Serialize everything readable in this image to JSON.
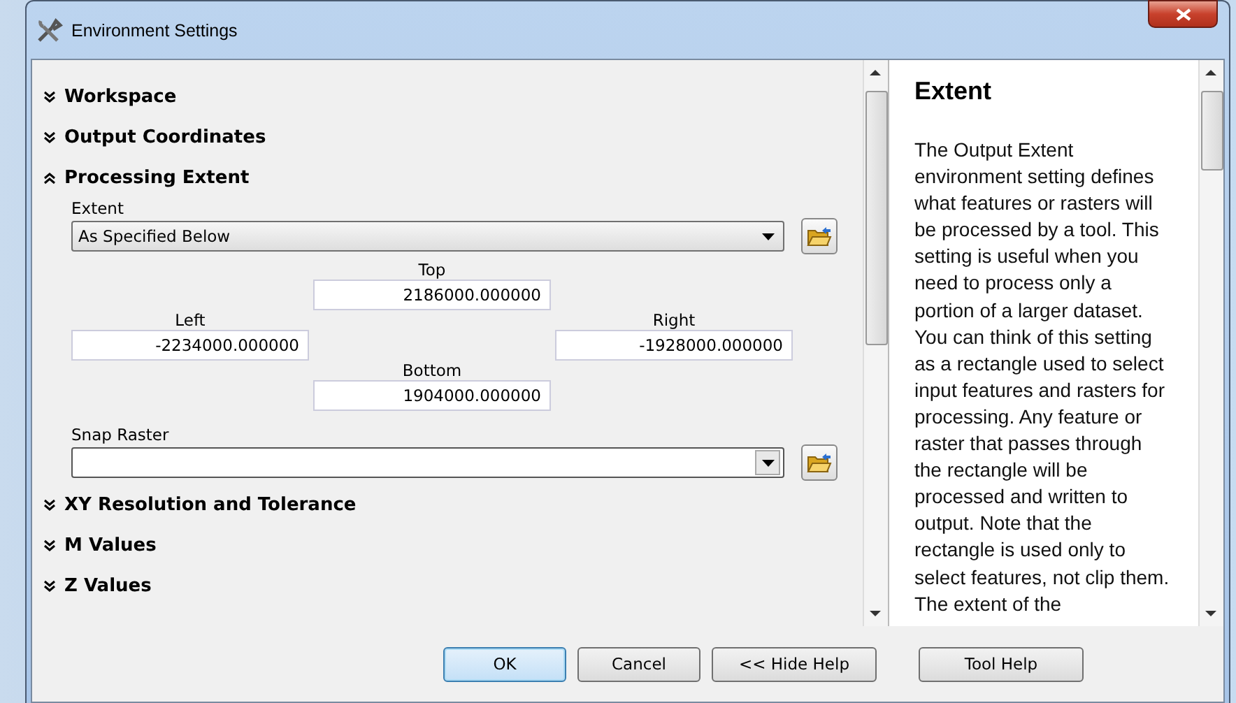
{
  "window": {
    "title": "Environment Settings"
  },
  "sections": [
    {
      "title": "Workspace",
      "expanded": false
    },
    {
      "title": "Output Coordinates",
      "expanded": false
    },
    {
      "title": "Processing Extent",
      "expanded": true,
      "extent": {
        "label": "Extent",
        "value": "As Specified Below"
      },
      "top": {
        "label": "Top",
        "value": "2186000.000000"
      },
      "left": {
        "label": "Left",
        "value": "-2234000.000000"
      },
      "right": {
        "label": "Right",
        "value": "-1928000.000000"
      },
      "bottom": {
        "label": "Bottom",
        "value": "1904000.000000"
      },
      "snap_raster": {
        "label": "Snap Raster"
      }
    },
    {
      "title": "XY Resolution and Tolerance",
      "expanded": false
    },
    {
      "title": "M Values",
      "expanded": false
    },
    {
      "title": "Z Values",
      "expanded": false
    }
  ],
  "help": {
    "title": "Extent",
    "text": "The Output Extent environment setting defines what features or rasters will be processed by a tool. This setting is useful when you need to process only a portion of a larger dataset. You can think of this setting as a rectangle used to select input features and rasters for processing. Any feature or raster that passes through the rectangle will be processed and written to output. Note that the rectangle is used only to select features, not clip them. The extent of the"
  },
  "buttons": [
    {
      "label": "OK",
      "default": true
    },
    {
      "label": "Cancel",
      "default": false
    },
    {
      "label": "<< Hide Help",
      "default": false
    },
    {
      "label": "Tool Help",
      "default": false
    }
  ]
}
